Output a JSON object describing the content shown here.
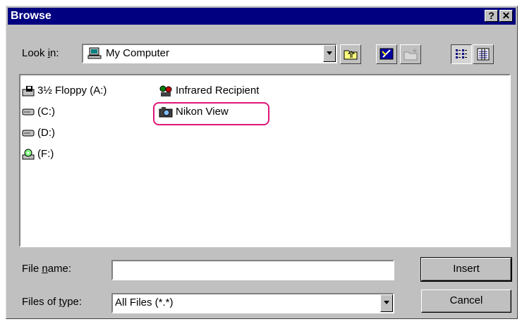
{
  "window": {
    "title": "Browse",
    "help_label": "?",
    "close_label": "✕"
  },
  "look_in": {
    "label_pre": "Look ",
    "label_u": "i",
    "label_post": "n:",
    "value": "My Computer"
  },
  "items": [
    {
      "label": "3½ Floppy (A:)",
      "icon": "floppy-drive-icon"
    },
    {
      "label": "(C:)",
      "icon": "hard-drive-icon"
    },
    {
      "label": "(D:)",
      "icon": "hard-drive-icon"
    },
    {
      "label": "(F:)",
      "icon": "cdrom-drive-icon"
    },
    {
      "label": "Infrared Recipient",
      "icon": "infrared-icon"
    },
    {
      "label": "Nikon View",
      "icon": "camera-icon"
    }
  ],
  "file_name": {
    "label_pre": "File ",
    "label_u": "n",
    "label_post": "ame:",
    "value": ""
  },
  "files_of_type": {
    "label_pre": "Files of ",
    "label_u": "t",
    "label_post": "ype:",
    "value": "All Files (*.*)"
  },
  "buttons": {
    "insert": "Insert",
    "cancel": "Cancel"
  },
  "colors": {
    "title_bar": "#000080",
    "highlight": "#e0147a",
    "face": "#c0c0c0"
  }
}
